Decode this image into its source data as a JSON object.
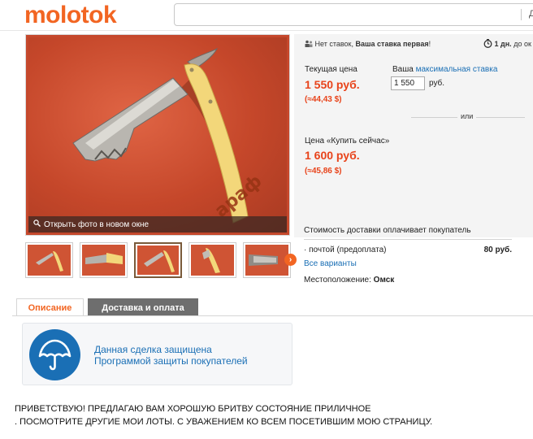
{
  "header": {
    "logo": "molotok",
    "search_value": "",
    "search_cut_text": "Д"
  },
  "photo": {
    "caption": "Открыть фото в новом окне",
    "watermark": "араф",
    "thumbnail_count": 5,
    "selected_thumbnail": 3,
    "thumb_next_icon": "chevron-right-icon"
  },
  "bids": {
    "no_bids": "Нет ставок,",
    "first_bid": "Ваша ставка первая",
    "excl": "!",
    "timer_value": "1 дн.",
    "timer_suffix": "до ок"
  },
  "pricing": {
    "current_label": "Текущая цена",
    "current_price": "1 550 руб.",
    "current_alt": "(≈44,43 $)",
    "max_bid_prefix": "Ваша",
    "max_bid_link": "максимальная ставка",
    "bid_value": "1 550",
    "bid_currency": "руб.",
    "or_text": "или",
    "buynow_label": "Цена «Купить сейчас»",
    "buynow_price": "1 600 руб.",
    "buynow_alt": "(≈45,86 $)"
  },
  "shipping": {
    "title": "Стоимость доставки оплачивает покупатель",
    "rows": [
      {
        "name": "почтой (предоплата)",
        "cost": "80 руб."
      }
    ],
    "all_options": "Все варианты",
    "location_label": "Местоположение:",
    "location_value": "Омск"
  },
  "tabs": {
    "description": "Описание",
    "delivery": "Доставка и оплата"
  },
  "protection": {
    "line1": "Данная сделка защищена",
    "line2": "Программой защиты покупателей"
  },
  "description": {
    "line1": "ПРИВЕТСТВУЮ! ПРЕДЛАГАЮ ВАМ ХОРОШУЮ БРИТВУ СОСТОЯНИЕ ПРИЛИЧНОЕ",
    "line2": ". ПОСМОТРИТЕ ДРУГИЕ МОИ ЛОТЫ. С УВАЖЕНИЕМ КО ВСЕМ ПОСЕТИВШИМ МОЮ СТРАНИЦУ."
  },
  "colors": {
    "brand_orange": "#f26522",
    "price_red": "#e8431a",
    "link_blue": "#1a6fb5",
    "photo_red": "#c5482c",
    "handle_yellow": "#f3d77a"
  }
}
